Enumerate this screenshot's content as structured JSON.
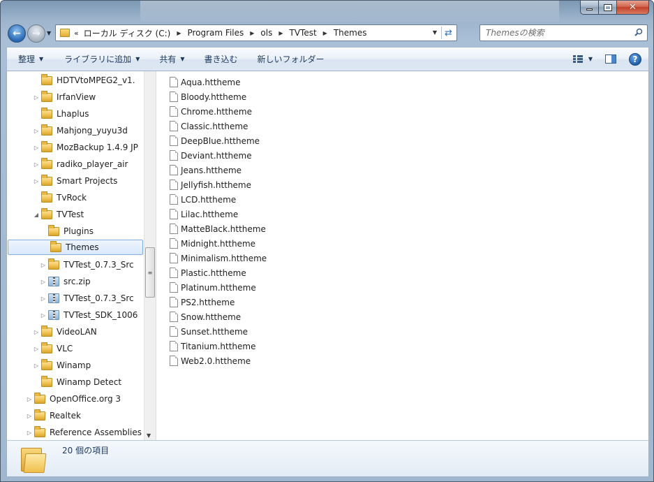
{
  "window": {
    "caption_buttons": {
      "minimize": "",
      "maximize": "",
      "close": "✕"
    }
  },
  "address_bar": {
    "overflow": "«",
    "breadcrumbs": [
      "ローカル ディスク (C:)",
      "Program Files",
      "ols",
      "TVTest",
      "Themes"
    ]
  },
  "search": {
    "placeholder": "Themesの検索"
  },
  "command_bar": {
    "organize": "整理",
    "add_to_library": "ライブラリに追加",
    "share": "共有",
    "burn": "書き込む",
    "new_folder": "新しいフォルダー",
    "help": "?"
  },
  "nav_tree": [
    {
      "label": "HDTVtoMPEG2_v1.",
      "icon": "folder-icon",
      "expander": "",
      "level": 1
    },
    {
      "label": "IrfanView",
      "icon": "folder-icon",
      "expander": "▷",
      "level": 1
    },
    {
      "label": "Lhaplus",
      "icon": "folder-icon",
      "expander": "",
      "level": 1
    },
    {
      "label": "Mahjong_yuyu3d",
      "icon": "folder-icon",
      "expander": "▷",
      "level": 1
    },
    {
      "label": "MozBackup 1.4.9 JP",
      "icon": "folder-icon",
      "expander": "▷",
      "level": 1
    },
    {
      "label": "radiko_player_air",
      "icon": "folder-icon",
      "expander": "▷",
      "level": 1
    },
    {
      "label": "Smart Projects",
      "icon": "folder-icon",
      "expander": "▷",
      "level": 1
    },
    {
      "label": "TvRock",
      "icon": "folder-icon",
      "expander": "",
      "level": 1
    },
    {
      "label": "TVTest",
      "icon": "folder-icon",
      "expander": "◢",
      "level": 1
    },
    {
      "label": "Plugins",
      "icon": "folder-icon",
      "expander": "",
      "level": 2
    },
    {
      "label": "Themes",
      "icon": "folder-icon",
      "expander": "",
      "level": 2,
      "selected": true
    },
    {
      "label": "TVTest_0.7.3_Src",
      "icon": "folder-icon",
      "expander": "▷",
      "level": 2
    },
    {
      "label": "src.zip",
      "icon": "zip-icon",
      "expander": "▷",
      "level": 2
    },
    {
      "label": "TVTest_0.7.3_Src",
      "icon": "zip-icon",
      "expander": "▷",
      "level": 2
    },
    {
      "label": "TVTest_SDK_1006",
      "icon": "zip-icon",
      "expander": "▷",
      "level": 2
    },
    {
      "label": "VideoLAN",
      "icon": "folder-icon",
      "expander": "▷",
      "level": 1
    },
    {
      "label": "VLC",
      "icon": "folder-icon",
      "expander": "▷",
      "level": 1
    },
    {
      "label": "Winamp",
      "icon": "folder-icon",
      "expander": "▷",
      "level": 1
    },
    {
      "label": "Winamp Detect",
      "icon": "folder-icon",
      "expander": "",
      "level": 1
    },
    {
      "label": "OpenOffice.org 3",
      "icon": "folder-icon",
      "expander": "▷",
      "level": 0
    },
    {
      "label": "Realtek",
      "icon": "folder-icon",
      "expander": "▷",
      "level": 0
    },
    {
      "label": "Reference Assemblies",
      "icon": "folder-icon",
      "expander": "▷",
      "level": 0
    }
  ],
  "files": [
    "Aqua.httheme",
    "Bloody.httheme",
    "Chrome.httheme",
    "Classic.httheme",
    "DeepBlue.httheme",
    "Deviant.httheme",
    "Jeans.httheme",
    "Jellyfish.httheme",
    "LCD.httheme",
    "Lilac.httheme",
    "MatteBlack.httheme",
    "Midnight.httheme",
    "Minimalism.httheme",
    "Plastic.httheme",
    "Platinum.httheme",
    "PS2.httheme",
    "Snow.httheme",
    "Sunset.httheme",
    "Titanium.httheme",
    "Web2.0.httheme"
  ],
  "details": {
    "item_count": "20 個の項目"
  },
  "colors": {
    "accent": "#1e395b",
    "selection": "#d9e8fb",
    "selection_border": "#84acdd"
  }
}
